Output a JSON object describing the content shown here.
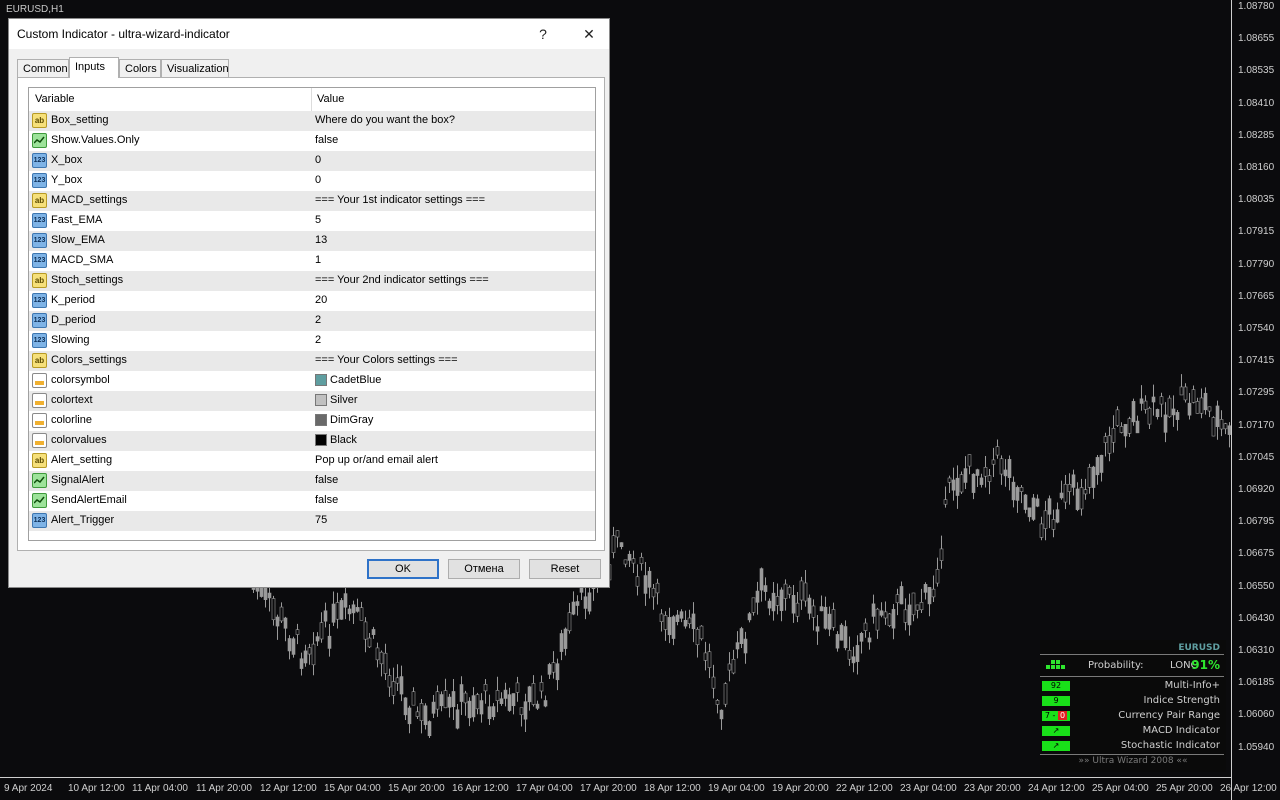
{
  "chart": {
    "symbol_label": "EURUSD,H1",
    "price_ticks": [
      "1.08780",
      "1.08655",
      "1.08535",
      "1.08410",
      "1.08285",
      "1.08160",
      "1.08035",
      "1.07915",
      "1.07790",
      "1.07665",
      "1.07540",
      "1.07415",
      "1.07295",
      "1.07170",
      "1.07045",
      "1.06920",
      "1.06795",
      "1.06675",
      "1.06550",
      "1.06430",
      "1.06310",
      "1.06185",
      "1.06060",
      "1.05940"
    ],
    "time_ticks": [
      "9 Apr 2024",
      "10 Apr 12:00",
      "11 Apr 04:00",
      "11 Apr 20:00",
      "12 Apr 12:00",
      "15 Apr 04:00",
      "15 Apr 20:00",
      "16 Apr 12:00",
      "17 Apr 04:00",
      "17 Apr 20:00",
      "18 Apr 12:00",
      "19 Apr 04:00",
      "19 Apr 20:00",
      "22 Apr 12:00",
      "23 Apr 04:00",
      "23 Apr 20:00",
      "24 Apr 12:00",
      "25 Apr 04:00",
      "25 Apr 20:00",
      "26 Apr 12:00"
    ],
    "colors": {
      "background": "#0b0b0d",
      "candle": "#9a9a9a"
    }
  },
  "dialog": {
    "title": "Custom Indicator - ultra-wizard-indicator",
    "help_label": "?",
    "close_label": "✕",
    "tabs": [
      "Common",
      "Inputs",
      "Colors",
      "Visualization"
    ],
    "active_tab": "Inputs",
    "grid": {
      "col_variable": "Variable",
      "col_value": "Value",
      "rows": [
        {
          "type": "ab",
          "name": "Box_setting",
          "value": "Where do you want the box?"
        },
        {
          "type": "bool",
          "name": "Show.Values.Only",
          "value": "false"
        },
        {
          "type": "num",
          "name": "X_box",
          "value": "0"
        },
        {
          "type": "num",
          "name": "Y_box",
          "value": "0"
        },
        {
          "type": "ab",
          "name": "MACD_settings",
          "value": "=== Your 1st indicator settings ==="
        },
        {
          "type": "num",
          "name": "Fast_EMA",
          "value": "5"
        },
        {
          "type": "num",
          "name": "Slow_EMA",
          "value": "13"
        },
        {
          "type": "num",
          "name": "MACD_SMA",
          "value": "1"
        },
        {
          "type": "ab",
          "name": "Stoch_settings",
          "value": "=== Your 2nd indicator settings ==="
        },
        {
          "type": "num",
          "name": "K_period",
          "value": "20"
        },
        {
          "type": "num",
          "name": "D_period",
          "value": "2"
        },
        {
          "type": "num",
          "name": "Slowing",
          "value": "2"
        },
        {
          "type": "ab",
          "name": "Colors_settings",
          "value": "=== Your Colors settings ==="
        },
        {
          "type": "color",
          "name": "colorsymbol",
          "value": "CadetBlue",
          "swatch": "#5f9ea0"
        },
        {
          "type": "color",
          "name": "colortext",
          "value": "Silver",
          "swatch": "#c0c0c0"
        },
        {
          "type": "color",
          "name": "colorline",
          "value": "DimGray",
          "swatch": "#696969"
        },
        {
          "type": "color",
          "name": "colorvalues",
          "value": "Black",
          "swatch": "#000000"
        },
        {
          "type": "ab",
          "name": "Alert_setting",
          "value": "Pop up or/and email alert"
        },
        {
          "type": "bool",
          "name": "SignalAlert",
          "value": "false"
        },
        {
          "type": "bool",
          "name": "SendAlertEmail",
          "value": "false"
        },
        {
          "type": "num",
          "name": "Alert_Trigger",
          "value": "75"
        }
      ]
    },
    "buttons": {
      "ok": "OK",
      "cancel": "Отмена",
      "reset": "Reset"
    }
  },
  "info_panel": {
    "symbol": "EURUSD",
    "probability_label": "Probability:",
    "direction": "LONG",
    "probability_value": "91%",
    "rows": [
      {
        "badge": "92",
        "label": "Multi-Info+"
      },
      {
        "badge": "9",
        "label": "Indice Strength"
      },
      {
        "badge": "7",
        "badge_red": "0",
        "label": "Currency Pair Range"
      },
      {
        "badge": "↗",
        "label": "MACD Indicator"
      },
      {
        "badge": "↗",
        "label": "Stochastic Indicator"
      }
    ],
    "footer": "»»  Ultra Wizard 2008  ««",
    "colors": {
      "accent": "#2ee62e",
      "symbol": "#5f9ea0",
      "text": "#d0d0d0"
    }
  }
}
